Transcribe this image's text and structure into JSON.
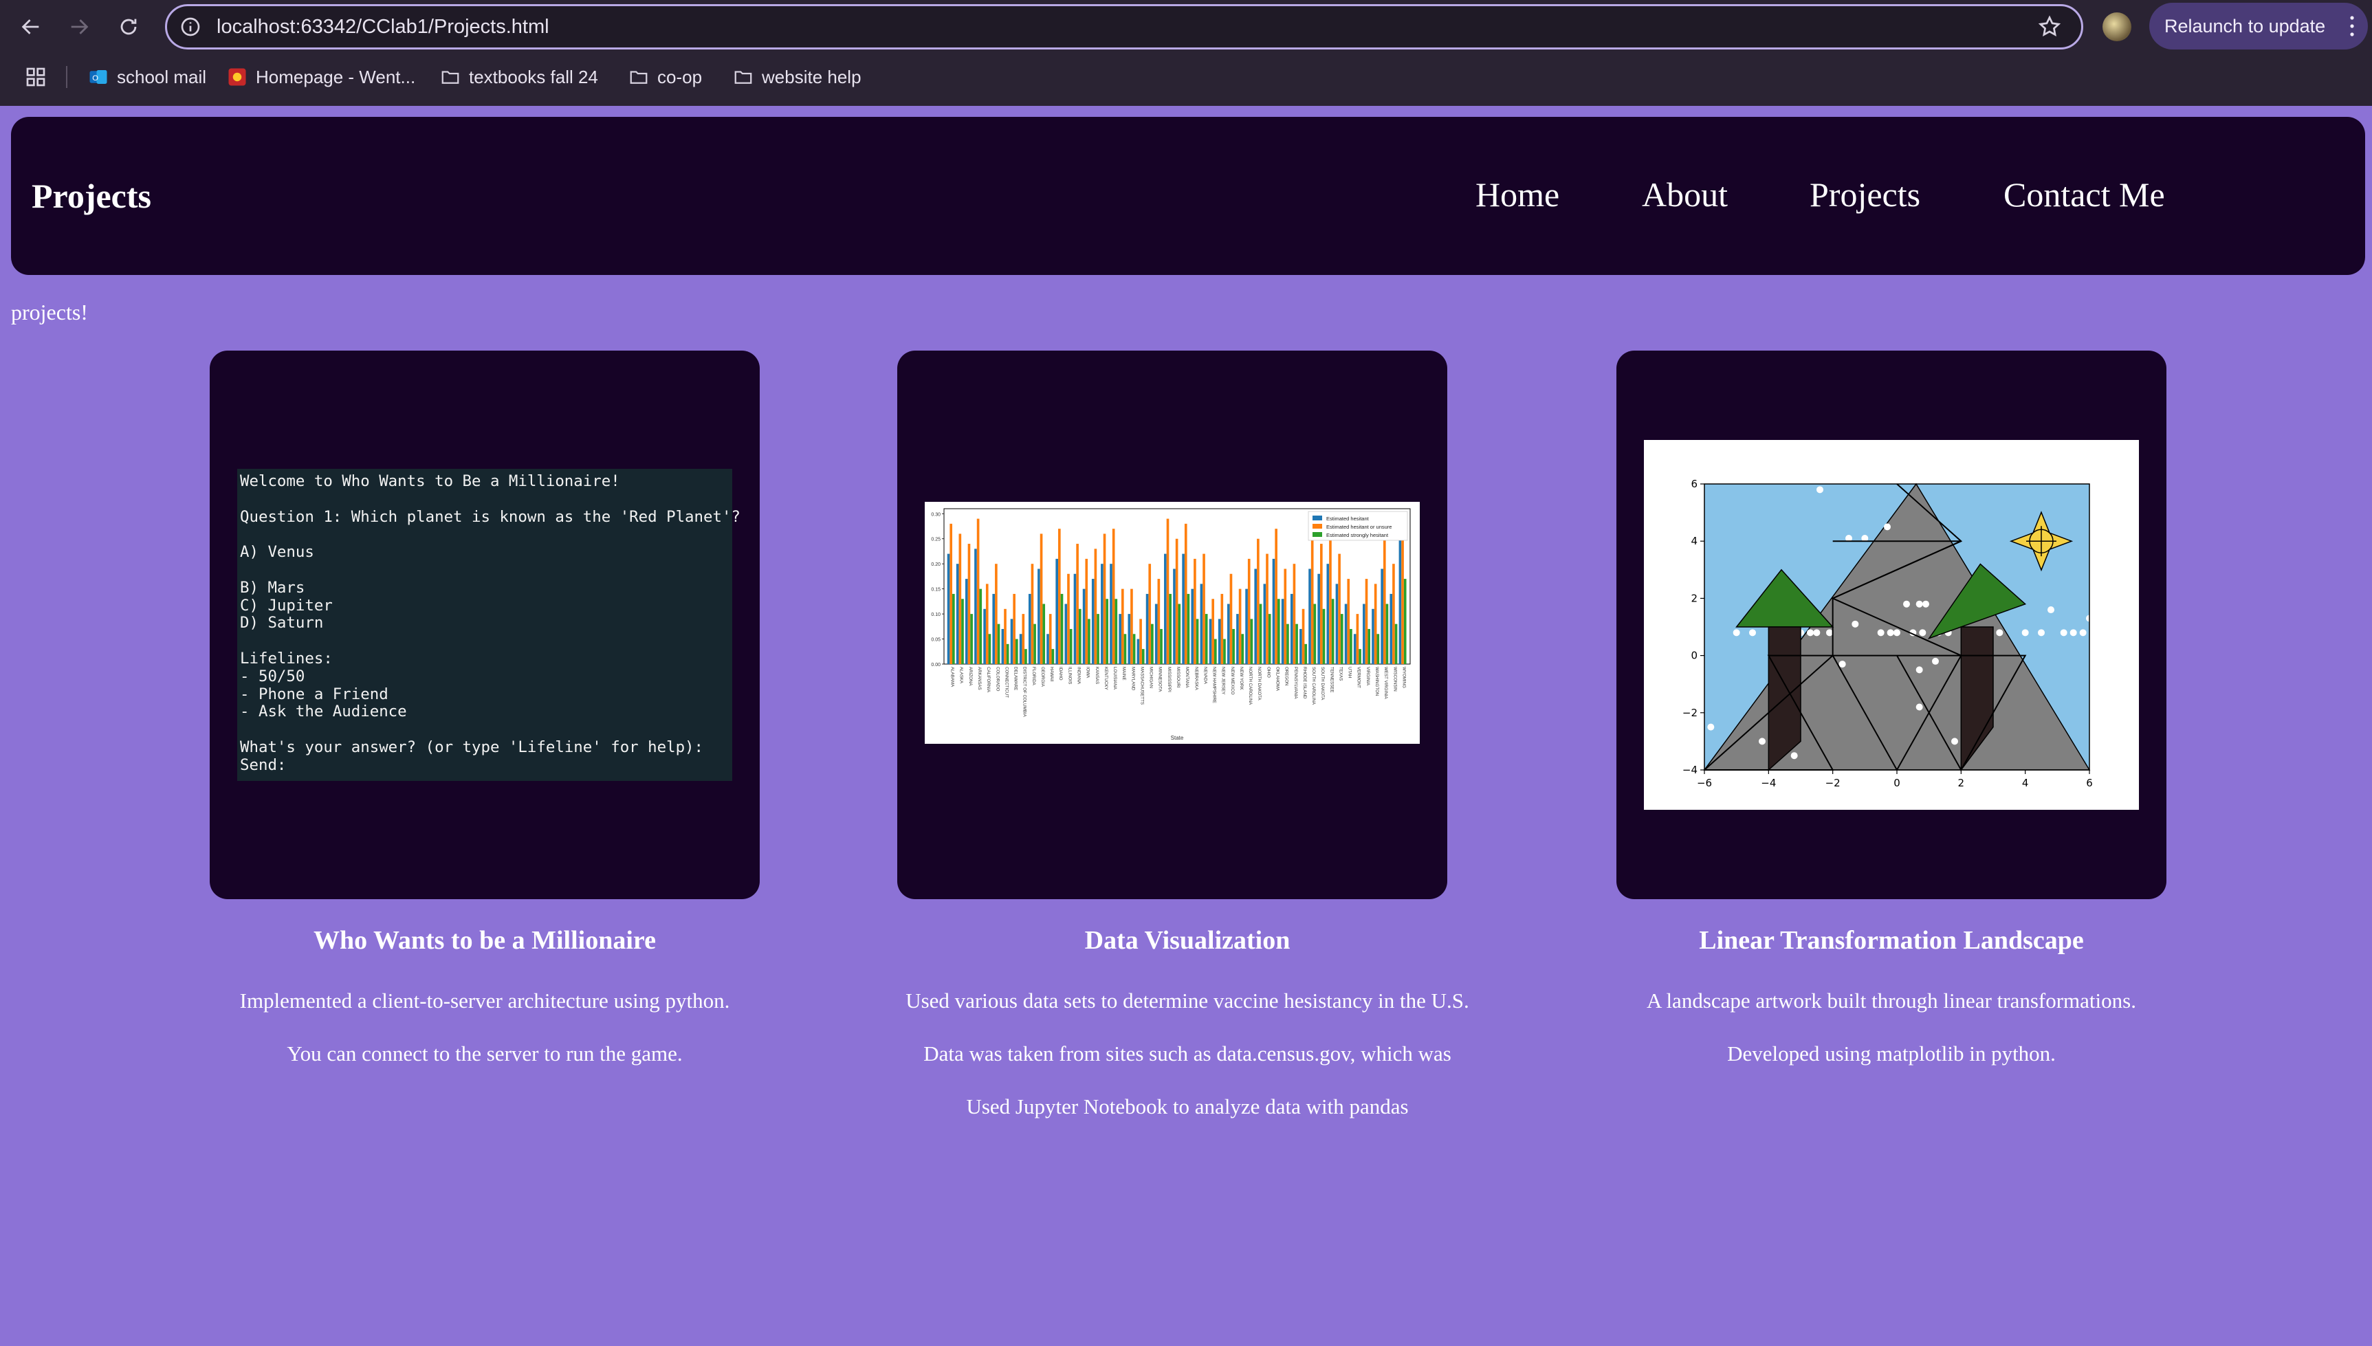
{
  "browser": {
    "url": "localhost:63342/CClab1/Projects.html",
    "relaunch_label": "Relaunch to update",
    "bookmarks": [
      {
        "label": "school mail",
        "icon": "outlook-icon"
      },
      {
        "label": "Homepage - Went...",
        "icon": "red-site-icon"
      },
      {
        "label": "textbooks fall 24",
        "icon": "folder-icon"
      },
      {
        "label": "co-op",
        "icon": "folder-icon"
      },
      {
        "label": "website help",
        "icon": "folder-icon"
      }
    ]
  },
  "header": {
    "brand": "Projects",
    "nav": [
      "Home",
      "About",
      "Projects",
      "Contact Me"
    ]
  },
  "intro": "projects!",
  "projects": [
    {
      "title": "Who Wants to be a Millionaire",
      "lines": [
        "Implemented a client-to-server architecture using python.",
        "You can connect to the server to run the game."
      ],
      "terminal": [
        "Welcome to Who Wants to Be a Millionaire!",
        "",
        "Question 1: Which planet is known as the 'Red Planet'?",
        "",
        "A) Venus",
        "",
        "B) Mars",
        "C) Jupiter",
        "D) Saturn",
        "",
        "Lifelines:",
        "- 50/50",
        "- Phone a Friend",
        "- Ask the Audience",
        "",
        "What's your answer? (or type 'Lifeline' for help):",
        "Send:"
      ]
    },
    {
      "title": "Data Visualization",
      "lines": [
        "Used various data sets to determine vaccine hesistancy in the U.S.",
        "Data was taken from sites such as data.census.gov, which was",
        "Used Jupyter Notebook to analyze data with pandas"
      ]
    },
    {
      "title": "Linear Transformation Landscape",
      "lines": [
        "A landscape artwork built through linear transformations.",
        "Developed using matplotlib in python."
      ]
    }
  ],
  "chart_data": [
    {
      "type": "bar",
      "xlabel": "State",
      "ylabel": "",
      "ylim": [
        0,
        0.31
      ],
      "yticks": [
        0.0,
        0.05,
        0.1,
        0.15,
        0.2,
        0.25,
        0.3
      ],
      "legend_position": "top-right",
      "categories": [
        "ALABAMA",
        "ALASKA",
        "ARIZONA",
        "ARKANSAS",
        "CALIFORNIA",
        "COLORADO",
        "CONNECTICUT",
        "DELAWARE",
        "DISTRICT OF COLUMBIA",
        "FLORIDA",
        "GEORGIA",
        "HAWAII",
        "IDAHO",
        "ILLINOIS",
        "INDIANA",
        "IOWA",
        "KANSAS",
        "KENTUCKY",
        "LOUISIANA",
        "MAINE",
        "MARYLAND",
        "MASSACHUSETTS",
        "MICHIGAN",
        "MINNESOTA",
        "MISSISSIPPI",
        "MISSOURI",
        "MONTANA",
        "NEBRASKA",
        "NEVADA",
        "NEW HAMPSHIRE",
        "NEW JERSEY",
        "NEW MEXICO",
        "NEW YORK",
        "NORTH CAROLINA",
        "NORTH DAKOTA",
        "OHIO",
        "OKLAHOMA",
        "OREGON",
        "PENNSYLVANIA",
        "RHODE ISLAND",
        "SOUTH CAROLINA",
        "SOUTH DAKOTA",
        "TENNESSEE",
        "TEXAS",
        "UTAH",
        "VERMONT",
        "VIRGINIA",
        "WASHINGTON",
        "WEST VIRGINIA",
        "WISCONSIN",
        "WYOMING"
      ],
      "series": [
        {
          "name": "Estimated hesitant",
          "color": "#1f77b4",
          "values": [
            0.22,
            0.2,
            0.17,
            0.23,
            0.11,
            0.14,
            0.07,
            0.09,
            0.06,
            0.14,
            0.19,
            0.06,
            0.21,
            0.12,
            0.18,
            0.15,
            0.17,
            0.2,
            0.2,
            0.1,
            0.1,
            0.05,
            0.14,
            0.12,
            0.22,
            0.19,
            0.22,
            0.15,
            0.16,
            0.09,
            0.09,
            0.12,
            0.1,
            0.15,
            0.19,
            0.16,
            0.21,
            0.13,
            0.14,
            0.07,
            0.19,
            0.18,
            0.2,
            0.16,
            0.12,
            0.06,
            0.12,
            0.11,
            0.19,
            0.14,
            0.25
          ]
        },
        {
          "name": "Estimated hesitant or unsure",
          "color": "#ff7f0e",
          "values": [
            0.28,
            0.26,
            0.24,
            0.29,
            0.16,
            0.2,
            0.11,
            0.14,
            0.1,
            0.2,
            0.26,
            0.1,
            0.27,
            0.18,
            0.24,
            0.21,
            0.23,
            0.26,
            0.27,
            0.15,
            0.15,
            0.09,
            0.2,
            0.17,
            0.29,
            0.25,
            0.28,
            0.21,
            0.22,
            0.13,
            0.14,
            0.18,
            0.15,
            0.21,
            0.25,
            0.22,
            0.27,
            0.19,
            0.2,
            0.11,
            0.25,
            0.24,
            0.26,
            0.22,
            0.17,
            0.1,
            0.17,
            0.16,
            0.25,
            0.2,
            0.3
          ]
        },
        {
          "name": "Estimated strongly hesitant",
          "color": "#2ca02c",
          "values": [
            0.14,
            0.13,
            0.1,
            0.15,
            0.06,
            0.08,
            0.04,
            0.05,
            0.03,
            0.08,
            0.12,
            0.03,
            0.14,
            0.07,
            0.11,
            0.09,
            0.1,
            0.13,
            0.13,
            0.06,
            0.06,
            0.03,
            0.08,
            0.07,
            0.14,
            0.12,
            0.14,
            0.09,
            0.1,
            0.05,
            0.05,
            0.07,
            0.06,
            0.09,
            0.12,
            0.1,
            0.13,
            0.08,
            0.08,
            0.04,
            0.12,
            0.11,
            0.13,
            0.1,
            0.07,
            0.03,
            0.07,
            0.06,
            0.12,
            0.08,
            0.17
          ]
        }
      ]
    },
    {
      "type": "scatter",
      "xlim": [
        -6,
        6
      ],
      "ylim": [
        -4,
        6
      ],
      "xticks": [
        -6,
        -4,
        -2,
        0,
        2,
        4,
        6
      ],
      "yticks": [
        -4,
        -2,
        0,
        2,
        4,
        6
      ],
      "background": "#88c3e8",
      "mountain_color": "#808080",
      "tree_color": "#2e7d22",
      "trunk_color": "#2b1e1e",
      "sun_color": "#f5d142",
      "mountain": [
        [
          -6,
          -4
        ],
        [
          0.6,
          6
        ],
        [
          6,
          -4
        ]
      ],
      "shapes": [
        {
          "kind": "polygon",
          "role": "tree",
          "points": [
            [
              -5,
              1
            ],
            [
              -3.6,
              3
            ],
            [
              -2,
              1
            ]
          ]
        },
        {
          "kind": "polygon",
          "role": "tree",
          "points": [
            [
              1,
              0.6
            ],
            [
              2.6,
              3.2
            ],
            [
              4,
              1.8
            ]
          ]
        },
        {
          "kind": "polygon",
          "role": "trunk",
          "points": [
            [
              -4,
              -4
            ],
            [
              -4,
              1
            ],
            [
              -3,
              1
            ],
            [
              -3,
              -3
            ]
          ]
        },
        {
          "kind": "polygon",
          "role": "trunk",
          "points": [
            [
              2,
              -4
            ],
            [
              2,
              1
            ],
            [
              3,
              1
            ],
            [
              3,
              -2.5
            ]
          ]
        },
        {
          "kind": "polyline",
          "role": "lines",
          "points": [
            [
              -2,
              4
            ],
            [
              2,
              4
            ],
            [
              -2,
              2
            ],
            [
              2,
              0
            ],
            [
              -2,
              0
            ],
            [
              0,
              -4
            ],
            [
              2,
              0
            ],
            [
              4,
              0
            ],
            [
              2,
              -4
            ],
            [
              0,
              0
            ],
            [
              -4,
              0
            ],
            [
              -2,
              -4
            ],
            [
              -6,
              -4
            ]
          ]
        },
        {
          "kind": "polyline",
          "role": "lines",
          "points": [
            [
              -2,
              0
            ],
            [
              -6,
              -4
            ]
          ]
        },
        {
          "kind": "polyline",
          "role": "lines",
          "points": [
            [
              -2,
              2
            ],
            [
              -2,
              0
            ]
          ]
        },
        {
          "kind": "polyline",
          "role": "lines",
          "points": [
            [
              0,
              6
            ],
            [
              2,
              4
            ],
            [
              -2,
              2
            ]
          ]
        }
      ],
      "sun": {
        "x": 4.5,
        "y": 4
      },
      "points": [
        [
          -5.8,
          -2.5
        ],
        [
          -5,
          0.8
        ],
        [
          -4.5,
          0.8
        ],
        [
          -3.8,
          0.8
        ],
        [
          -3,
          0.8
        ],
        [
          -2.7,
          0.8
        ],
        [
          -2.5,
          0.8
        ],
        [
          -2.1,
          0.8
        ],
        [
          -3.2,
          -3.5
        ],
        [
          -1.7,
          -0.3
        ],
        [
          -1.5,
          4.1
        ],
        [
          -1,
          4.1
        ],
        [
          -0.3,
          4.5
        ],
        [
          -0.5,
          0.8
        ],
        [
          -0.2,
          0.8
        ],
        [
          0,
          0.8
        ],
        [
          0.5,
          0.8
        ],
        [
          0.8,
          0.8
        ],
        [
          1.3,
          0.8
        ],
        [
          1.6,
          0.8
        ],
        [
          2.5,
          0.8
        ],
        [
          3.2,
          0.8
        ],
        [
          4,
          0.8
        ],
        [
          4.5,
          0.8
        ],
        [
          5.2,
          0.8
        ],
        [
          5.5,
          0.8
        ],
        [
          5.8,
          0.8
        ],
        [
          6,
          1.3
        ],
        [
          0.3,
          1.8
        ],
        [
          0.7,
          1.8
        ],
        [
          0.9,
          1.8
        ],
        [
          2.5,
          1.7
        ],
        [
          4.8,
          1.6
        ],
        [
          -2.4,
          5.8
        ],
        [
          0.7,
          -0.5
        ],
        [
          0.7,
          -1.8
        ],
        [
          1.8,
          -3
        ],
        [
          -4.2,
          -3
        ],
        [
          1.2,
          -0.2
        ],
        [
          -1.3,
          1.1
        ]
      ]
    }
  ]
}
